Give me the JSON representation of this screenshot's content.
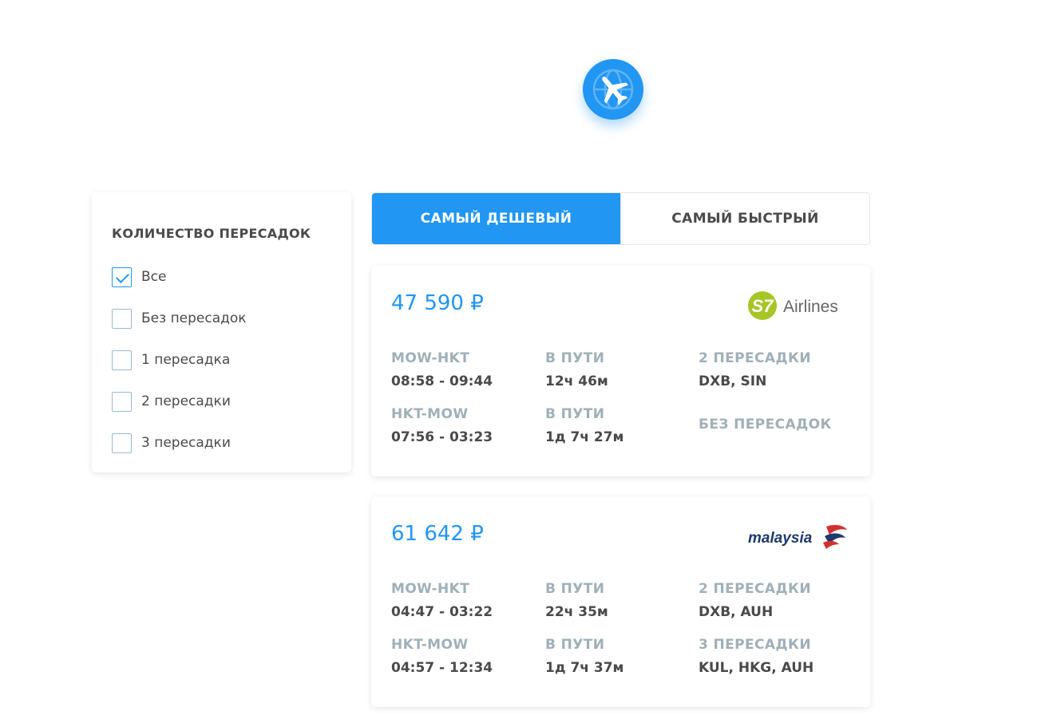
{
  "logo": {
    "icon": "airplane-globe-icon",
    "color": "#2196f3"
  },
  "filter": {
    "title": "КОЛИЧЕСТВО ПЕРЕСАДОК",
    "options": [
      {
        "label": "Все",
        "checked": true
      },
      {
        "label": "Без пересадок",
        "checked": false
      },
      {
        "label": "1 пересадка",
        "checked": false
      },
      {
        "label": "2 пересадки",
        "checked": false
      },
      {
        "label": "3 пересадки",
        "checked": false
      }
    ]
  },
  "tabs": {
    "cheapest": "САМЫЙ ДЕШЕВЫЙ",
    "fastest": "САМЫЙ БЫСТРЫЙ",
    "active": "cheapest"
  },
  "colors": {
    "accent": "#2196f3",
    "muted": "#a0b0b9",
    "text": "#4a4a4a"
  },
  "tickets": [
    {
      "price": "47 590 ₽",
      "carrier": {
        "logo_text": "S7",
        "name": "Airlines",
        "icon": "s7-airlines-logo"
      },
      "segments": [
        {
          "route": "MOW-HKT",
          "time": "08:58 - 09:44",
          "duration_label": "В ПУТИ",
          "duration": "12ч 46м",
          "stops_label": "2 ПЕРЕСАДКИ",
          "stops": "DXB, SIN"
        },
        {
          "route": "HKT-MOW",
          "time": "07:56 - 03:23",
          "duration_label": "В ПУТИ",
          "duration": "1д 7ч 27м",
          "stops_label": "БЕЗ ПЕРЕСАДОК",
          "stops": ""
        }
      ]
    },
    {
      "price": "61 642 ₽",
      "carrier": {
        "logo_text": "malaysia",
        "icon": "malaysia-airlines-logo"
      },
      "segments": [
        {
          "route": "MOW-HKT",
          "time": "04:47 - 03:22",
          "duration_label": "В ПУТИ",
          "duration": "22ч 35м",
          "stops_label": "2 ПЕРЕСАДКИ",
          "stops": "DXB, AUH"
        },
        {
          "route": "HKT-MOW",
          "time": "04:57 - 12:34",
          "duration_label": "В ПУТИ",
          "duration": "1д 7ч 37м",
          "stops_label": "3 ПЕРЕСАДКИ",
          "stops": "KUL, HKG, AUH"
        }
      ]
    }
  ]
}
